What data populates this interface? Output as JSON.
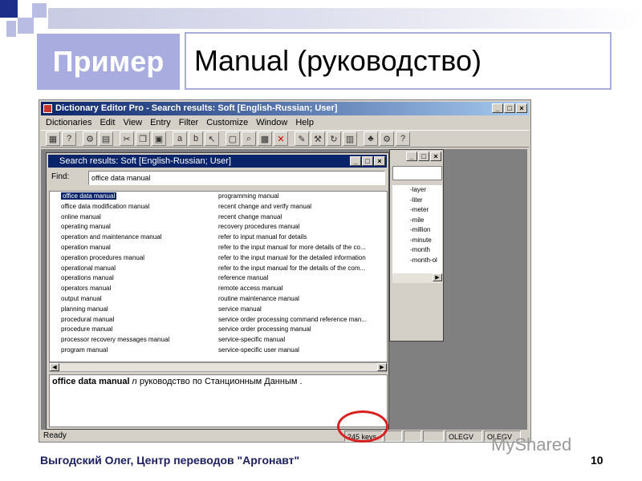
{
  "slide": {
    "title_left": "Пример",
    "title_right": "Manual (руководство)",
    "footer": "Выгодский Олег, Центр переводов \"Аргонавт\"",
    "page_number": "10",
    "watermark": "MyShared"
  },
  "app": {
    "title": "Dictionary Editor Pro - Search results: Soft [English-Russian; User]",
    "menu": [
      "Dictionaries",
      "Edit",
      "View",
      "Entry",
      "Filter",
      "Customize",
      "Window",
      "Help"
    ],
    "search_window": {
      "title": "Search results: Soft [English-Russian; User]",
      "find_label": "Find:",
      "find_value": "office data manual"
    },
    "results_left": [
      "office data manual",
      "office data modification manual",
      "online manual",
      "operating manual",
      "operation and maintenance manual",
      "operation manual",
      "operation procedures manual",
      "operational manual",
      "operations manual",
      "operators manual",
      "output manual",
      "planning manual",
      "procedural manual",
      "procedure manual",
      "processor recovery messages manual",
      "program manual"
    ],
    "results_right": [
      "programming manual",
      "recent change and verify manual",
      "recent change manual",
      "recovery procedures manual",
      "refer to input manual for details",
      "refer to the input manual for more details of the co...",
      "refer to the input manual for the detailed information",
      "refer to the input manual for the details of the com...",
      "reference manual",
      "remote access manual",
      "routine maintenance manual",
      "service manual",
      "service order processing command reference man...",
      "service order processing manual",
      "service-specific manual",
      "service-specific user manual"
    ],
    "definition": {
      "term": "office data manual",
      "pos": "n",
      "translation": "руководство по Станционным Данным ."
    },
    "back_list": [
      "-layer",
      "-liter",
      "-meter",
      "-mile",
      "-million",
      "-minute",
      "-month",
      "-month-ol"
    ],
    "status": {
      "left": "Ready",
      "keys": "245 keys",
      "user": "OLEGV",
      "user2": "OLEGV"
    }
  }
}
